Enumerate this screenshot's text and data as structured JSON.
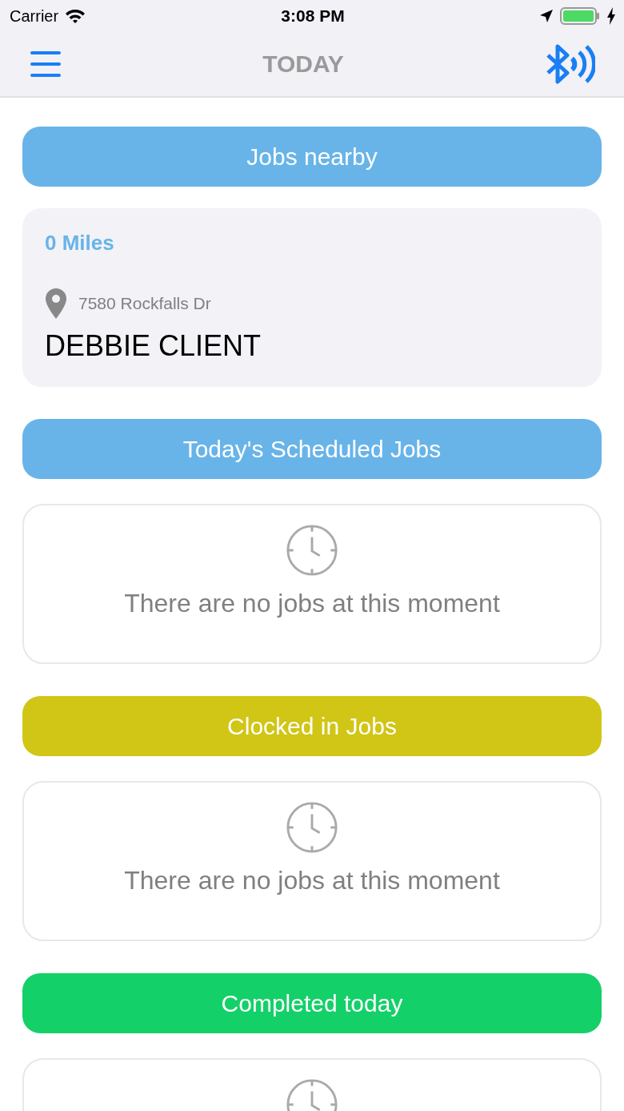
{
  "status_bar": {
    "carrier": "Carrier",
    "time": "3:08 PM"
  },
  "nav_bar": {
    "title": "TODAY"
  },
  "sections": [
    {
      "title": "Jobs nearby",
      "color": "#68b4e8",
      "kind": "jobs",
      "jobs": [
        {
          "distance": "0 Miles",
          "address": "7580 Rockfalls Dr",
          "client": "DEBBIE CLIENT"
        }
      ]
    },
    {
      "title": "Today's Scheduled Jobs",
      "color": "#68b4e8",
      "kind": "empty",
      "message": "There are no jobs at this moment"
    },
    {
      "title": "Clocked in Jobs",
      "color": "#d1c516",
      "kind": "empty",
      "message": "There are no jobs at this moment"
    },
    {
      "title": "Completed today",
      "color": "#14d068",
      "kind": "empty"
    }
  ]
}
